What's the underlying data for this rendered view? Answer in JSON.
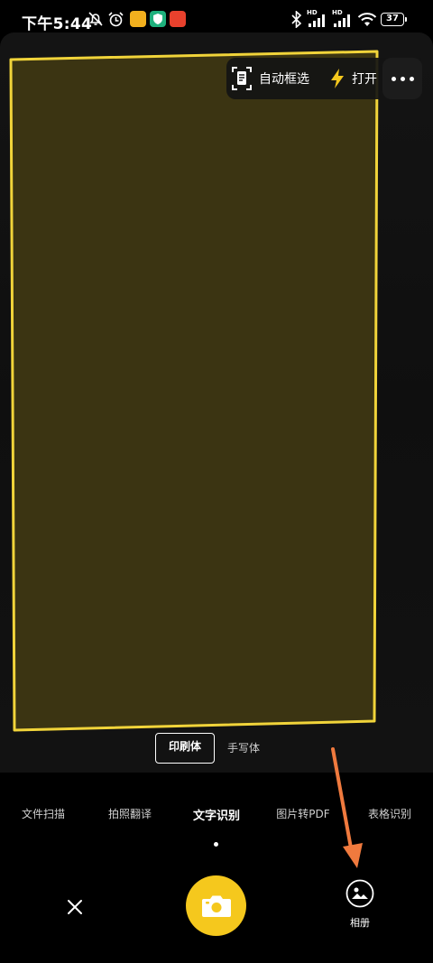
{
  "status_bar": {
    "time": "下午5:44",
    "battery": "37",
    "signal_label_1": "HD",
    "signal_label_2": "HD",
    "icons": [
      "notification-off-icon",
      "alarm-icon",
      "app-badge-1",
      "app-badge-2",
      "app-badge-3",
      "bluetooth-icon",
      "signal-icon",
      "signal-icon",
      "wifi-icon",
      "battery-icon"
    ]
  },
  "top_controls": {
    "auto_select_label": "自动框选",
    "flash_label": "打开",
    "more_icon": "more-icon"
  },
  "font_style": {
    "options": [
      "印刷体",
      "手写体"
    ],
    "selected": "印刷体"
  },
  "modes": {
    "items": [
      "文件扫描",
      "拍照翻译",
      "文字识别",
      "图片转PDF",
      "表格识别"
    ],
    "active": "文字识别"
  },
  "bottom_bar": {
    "album_label": "相册"
  },
  "colors": {
    "frame_stroke": "#f1d43a",
    "frame_fill": "#3b3412",
    "shutter": "#f5c81d",
    "arrow": "#f07a3e"
  }
}
